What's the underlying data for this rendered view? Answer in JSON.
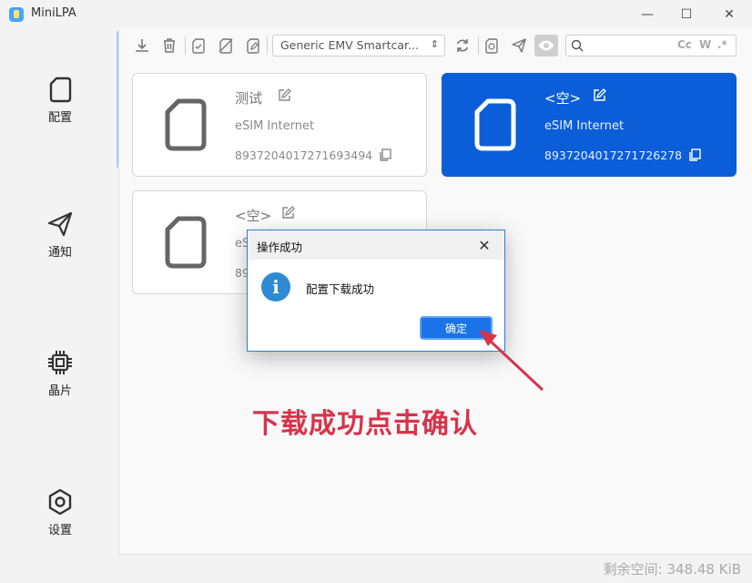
{
  "window": {
    "title": "MiniLPA",
    "minimize_glyph": "—",
    "maximize_glyph": "☐",
    "close_glyph": "✕"
  },
  "sidebar": {
    "items": [
      {
        "label": "配置",
        "icon": "sim-card-icon"
      },
      {
        "label": "通知",
        "icon": "paper-plane-icon"
      },
      {
        "label": "晶片",
        "icon": "chip-icon"
      },
      {
        "label": "设置",
        "icon": "hexagon-settings-icon"
      }
    ]
  },
  "toolbar": {
    "card_reader_selected": "Generic EMV Smartcar...",
    "search_placeholder": "",
    "search_options": [
      "Cc",
      "W",
      ".*"
    ]
  },
  "profiles": [
    {
      "name": "测试",
      "provider": "eSIM Internet",
      "iccid": "8937204017271693494",
      "selected": false
    },
    {
      "name": "<空>",
      "provider": "eSIM Internet",
      "iccid": "8937204017271726278",
      "selected": true
    },
    {
      "name": "<空>",
      "provider": "eS",
      "iccid": "89",
      "selected": false
    }
  ],
  "status_bar": {
    "free_space": "剩余空间: 348.48 KiB"
  },
  "dialog": {
    "title": "操作成功",
    "message": "配置下载成功",
    "ok_label": "确定",
    "close_glyph": "✕",
    "info_glyph": "i"
  },
  "annotation": {
    "text": "下载成功点击确认",
    "color": "#d6344c"
  },
  "colors": {
    "accent": "#0b5ed7",
    "dialog_button": "#1a73e8"
  }
}
